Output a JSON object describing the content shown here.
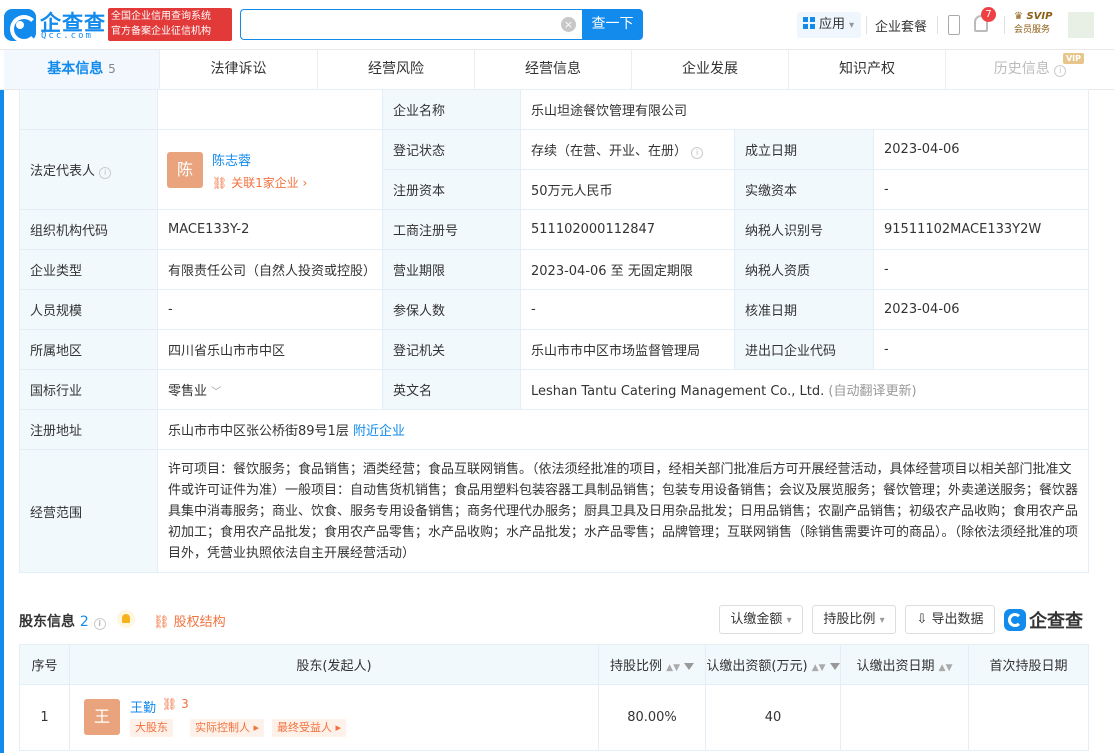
{
  "header": {
    "logo_text": "企查查",
    "logo_sub": "Qcc.com",
    "badge_line1": "全国企业信用查询系统",
    "badge_line2": "官方备案企业征信机构",
    "search_value": "",
    "search_button": "查一下",
    "app_button": "应用",
    "suite_link": "企业套餐",
    "notification_count": "7",
    "svip_top": "SVIP",
    "svip_bottom": "会员服务"
  },
  "tabs": [
    {
      "label": "基本信息",
      "count": "5"
    },
    {
      "label": "法律诉讼"
    },
    {
      "label": "经营风险"
    },
    {
      "label": "经营信息"
    },
    {
      "label": "企业发展"
    },
    {
      "label": "知识产权"
    },
    {
      "label": "历史信息",
      "tag": "VIP"
    }
  ],
  "info": {
    "company_name_label": "企业名称",
    "company_name": "乐山坦途餐饮管理有限公司",
    "legal_rep_label": "法定代表人",
    "legal_rep_avatar": "陈",
    "legal_rep_name": "陈志蓉",
    "legal_rep_related": "关联1家企业",
    "reg_status_label": "登记状态",
    "reg_status": "存续（在营、开业、在册）",
    "founded_label": "成立日期",
    "founded": "2023-04-06",
    "reg_capital_label": "注册资本",
    "reg_capital": "50万元人民币",
    "paid_capital_label": "实缴资本",
    "paid_capital": "-",
    "org_code_label": "组织机构代码",
    "org_code": "MACE133Y-2",
    "biz_reg_no_label": "工商注册号",
    "biz_reg_no": "511102000112847",
    "taxpayer_id_label": "纳税人识别号",
    "taxpayer_id": "91511102MACE133Y2W",
    "company_type_label": "企业类型",
    "company_type": "有限责任公司（自然人投资或控股）",
    "biz_term_label": "营业期限",
    "biz_term": "2023-04-06 至 无固定期限",
    "taxpayer_qual_label": "纳税人资质",
    "taxpayer_qual": "-",
    "staff_size_label": "人员规模",
    "staff_size": "-",
    "insured_label": "参保人数",
    "insured": "-",
    "approval_date_label": "核准日期",
    "approval_date": "2023-04-06",
    "region_label": "所属地区",
    "region": "四川省乐山市市中区",
    "reg_authority_label": "登记机关",
    "reg_authority": "乐山市市中区市场监督管理局",
    "import_export_label": "进出口企业代码",
    "import_export": "-",
    "industry_label": "国标行业",
    "industry": "零售业",
    "english_name_label": "英文名",
    "english_name": "Leshan Tantu Catering Management Co., Ltd.",
    "english_name_note": "(自动翻译更新)",
    "address_label": "注册地址",
    "address": "乐山市市中区张公桥街89号1层",
    "nearby_link": "附近企业",
    "scope_label": "经营范围",
    "scope": "许可项目：餐饮服务；食品销售；酒类经营；食品互联网销售。（依法须经批准的项目，经相关部门批准后方可开展经营活动，具体经营项目以相关部门批准文件或许可证件为准）一般项目：自动售货机销售；食品用塑料包装容器工具制品销售；包装专用设备销售；会议及展览服务；餐饮管理；外卖递送服务；餐饮器具集中消毒服务；商业、饮食、服务专用设备销售；商务代理代办服务；厨具卫具及日用杂品批发；日用品销售；农副产品销售；初级农产品收购；食用农产品初加工；食用农产品批发；食用农产品零售；水产品收购；水产品批发；水产品零售；品牌管理；互联网销售（除销售需要许可的商品）。（除依法须经批准的项目外，凭营业执照依法自主开展经营活动）"
  },
  "shareholders": {
    "title": "股东信息",
    "count": "2",
    "equity_link": "股权结构",
    "btn_amount": "认缴金额",
    "btn_ratio": "持股比例",
    "btn_export": "导出数据",
    "logo_text": "企查查",
    "columns": [
      "序号",
      "股东(发起人)",
      "持股比例",
      "认缴出资额(万元)",
      "认缴出资日期",
      "首次持股日期"
    ],
    "rows": [
      {
        "index": "1",
        "avatar": "王",
        "name": "王勤",
        "related": "3",
        "tags": [
          "大股东",
          "实际控制人",
          "最终受益人"
        ],
        "ratio": "80.00%",
        "amount": "40",
        "subscribe_date": "",
        "first_date": ""
      }
    ]
  }
}
